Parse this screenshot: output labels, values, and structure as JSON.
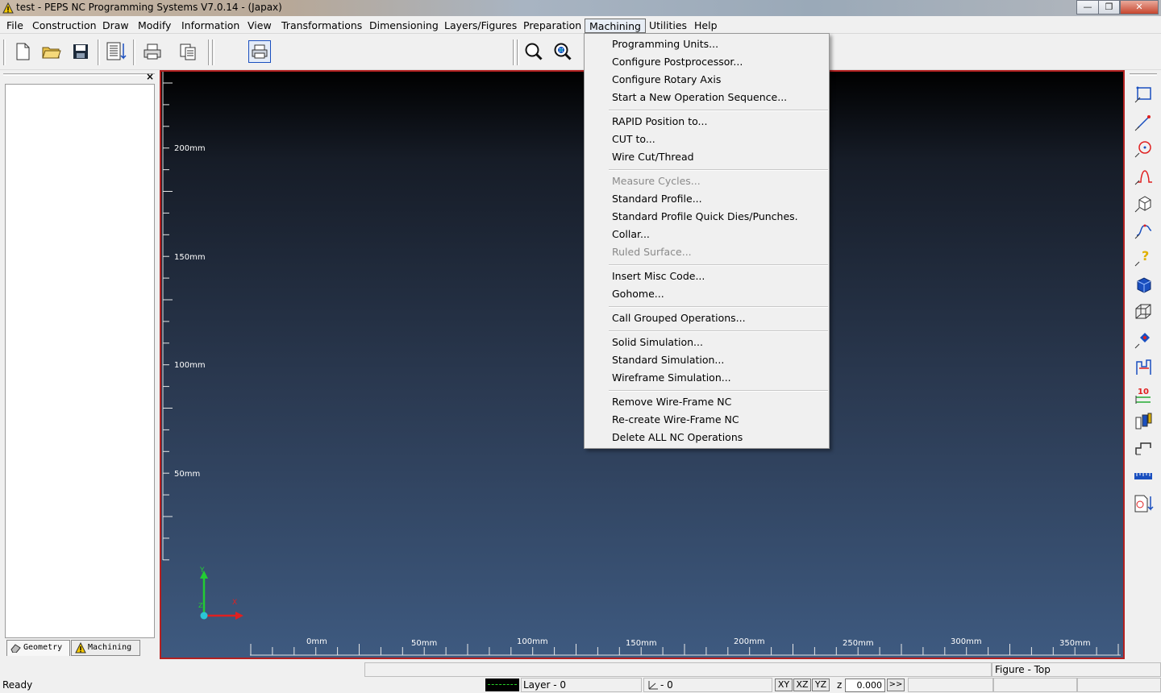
{
  "window": {
    "title": "test - PEPS NC Programming Systems V7.0.14 - (Japax)",
    "min_glyph": "—",
    "max_glyph": "❐",
    "close_glyph": "✕"
  },
  "menubar": {
    "items": [
      "File",
      "Construction",
      "Draw",
      "Modify",
      "Information",
      "View",
      "Transformations",
      "Dimensioning",
      "Layers/Figures",
      "Preparation",
      "Machining",
      "Utilities",
      "Help"
    ],
    "open_item": "Machining"
  },
  "toolbar": {
    "icons": [
      "new-file-icon",
      "open-folder-icon",
      "save-icon",
      "document-list-icon",
      "print-icon",
      "copy-icon",
      "print-preview-icon",
      "zoom-icon",
      "zoom-fit-icon"
    ]
  },
  "left_panel": {
    "close_glyph": "×",
    "tabs": [
      "Geometry",
      "Machining"
    ]
  },
  "canvas": {
    "v_labels": [
      "200mm",
      "150mm",
      "100mm",
      "50mm"
    ],
    "h_labels": [
      "0mm",
      "50mm",
      "100mm",
      "150mm",
      "200mm",
      "250mm",
      "300mm",
      "350mm"
    ],
    "axis_y": "Y",
    "axis_x": "X",
    "axis_z": "Z"
  },
  "machining_menu": {
    "groups": [
      [
        {
          "label": "Programming Units...",
          "enabled": true
        },
        {
          "label": "Configure Postprocessor...",
          "enabled": true
        },
        {
          "label": "Configure Rotary Axis",
          "enabled": true
        },
        {
          "label": "Start a New Operation Sequence...",
          "enabled": true
        }
      ],
      [
        {
          "label": "RAPID Position to...",
          "enabled": true
        },
        {
          "label": "CUT to...",
          "enabled": true
        },
        {
          "label": "Wire Cut/Thread",
          "enabled": true
        }
      ],
      [
        {
          "label": "Measure Cycles...",
          "enabled": false
        },
        {
          "label": "Standard Profile...",
          "enabled": true
        },
        {
          "label": "Standard Profile Quick Dies/Punches.",
          "enabled": true
        },
        {
          "label": "Collar...",
          "enabled": true
        },
        {
          "label": "Ruled Surface...",
          "enabled": false
        }
      ],
      [
        {
          "label": "Insert Misc Code...",
          "enabled": true
        },
        {
          "label": "Gohome...",
          "enabled": true
        }
      ],
      [
        {
          "label": "Call Grouped Operations...",
          "enabled": true
        }
      ],
      [
        {
          "label": "Solid Simulation...",
          "enabled": true
        },
        {
          "label": "Standard Simulation...",
          "enabled": true
        },
        {
          "label": "Wireframe Simulation...",
          "enabled": true
        }
      ],
      [
        {
          "label": "Remove Wire-Frame NC",
          "enabled": true
        },
        {
          "label": "Re-create Wire-Frame NC",
          "enabled": true
        },
        {
          "label": "Delete ALL NC Operations",
          "enabled": true
        }
      ]
    ]
  },
  "right_toolbar": {
    "icons": [
      "rectangle-select-icon",
      "line-icon",
      "circle-icon",
      "bell-shape-icon",
      "cube-icon",
      "spline-icon",
      "help-query-icon",
      "solid-block-icon",
      "wireframe-cube-icon",
      "transform-icon",
      "profile-steps-icon",
      "counter-10-icon",
      "tool-stack-icon",
      "die-shape-icon",
      "ruler-icon",
      "document-export-icon"
    ]
  },
  "status": {
    "ready": "Ready",
    "figure": "Figure - Top",
    "layer": "Layer - 0",
    "mode_value": "- 0",
    "planes": [
      "XY",
      "XZ",
      "YZ"
    ],
    "z_label": "z",
    "z_value": "0.000",
    "more": ">>"
  },
  "colors": {
    "accent_red": "#b32020",
    "axis_green": "#22cc33",
    "axis_red": "#e02020",
    "icon_blue": "#1a4fbf"
  }
}
